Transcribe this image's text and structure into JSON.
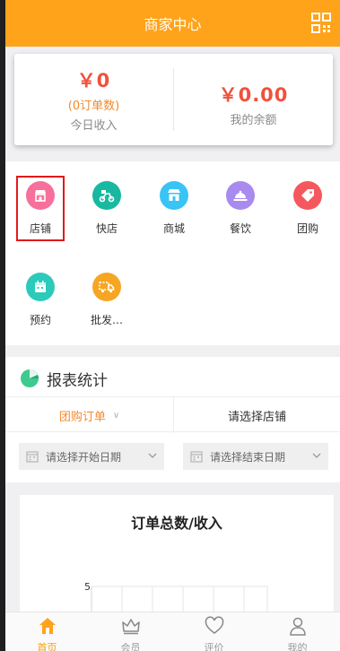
{
  "header": {
    "title": "商家中心",
    "qr_icon": "qr-code-icon"
  },
  "income": {
    "today_amount": "￥0",
    "today_orders": "(0订单数)",
    "today_label": "今日收入",
    "balance_amount": "￥0.00",
    "balance_label": "我的余额"
  },
  "menu": {
    "items": [
      {
        "label": "店铺",
        "icon": "store-icon",
        "color": "#f6709b"
      },
      {
        "label": "快店",
        "icon": "delivery-scooter-icon",
        "color": "#19b8a0"
      },
      {
        "label": "商城",
        "icon": "shop-icon",
        "color": "#38c4f5"
      },
      {
        "label": "餐饮",
        "icon": "food-cloche-icon",
        "color": "#a98aef"
      },
      {
        "label": "团购",
        "icon": "group-buy-tag-icon",
        "color": "#f4585d"
      },
      {
        "label": "预约",
        "icon": "calendar-icon",
        "color": "#2ccabb"
      },
      {
        "label": "批发…",
        "icon": "wholesale-truck-icon",
        "color": "#f6a623"
      }
    ]
  },
  "report": {
    "title": "报表统计",
    "filter_type": "团购订单",
    "filter_store": "请选择店铺",
    "start_date_placeholder": "请选择开始日期",
    "end_date_placeholder": "请选择结束日期"
  },
  "chart_data": {
    "type": "bar",
    "title": "订单总数/收入",
    "yticks": [
      "5"
    ],
    "categories": [],
    "values": []
  },
  "tabbar": {
    "items": [
      {
        "label": "首页",
        "icon": "home-icon",
        "active": true
      },
      {
        "label": "会员",
        "icon": "crown-icon",
        "active": false
      },
      {
        "label": "评价",
        "icon": "heart-icon",
        "active": false
      },
      {
        "label": "我的",
        "icon": "user-icon",
        "active": false
      }
    ]
  },
  "colors": {
    "primary": "#ffa31a",
    "money": "#f0523c",
    "accent_text": "#f28a2e"
  }
}
